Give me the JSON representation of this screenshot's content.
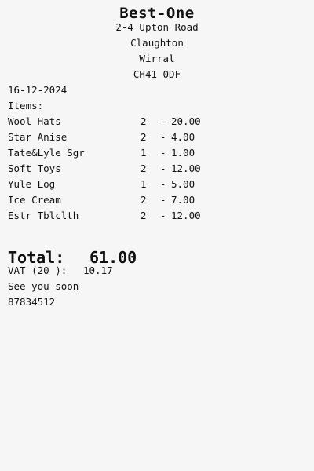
{
  "store": {
    "name": "Best-One",
    "address": [
      "2-4 Upton Road",
      "Claughton",
      "Wirral",
      "CH41 0DF"
    ]
  },
  "date": "16-12-2024",
  "items_label": "Items:",
  "items": [
    {
      "name": "Wool Hats",
      "qty": "2",
      "sep": "-",
      "price": "20.00"
    },
    {
      "name": "Star Anise",
      "qty": "2",
      "sep": "-",
      "price": "4.00"
    },
    {
      "name": "Tate&Lyle Sgr",
      "qty": "1",
      "sep": "-",
      "price": "1.00"
    },
    {
      "name": "Soft Toys",
      "qty": "2",
      "sep": "-",
      "price": "12.00"
    },
    {
      "name": "Yule Log",
      "qty": "1",
      "sep": "-",
      "price": "5.00"
    },
    {
      "name": "Ice Cream",
      "qty": "2",
      "sep": "-",
      "price": "7.00"
    },
    {
      "name": "Estr Tblclth",
      "qty": "2",
      "sep": "-",
      "price": "12.00"
    }
  ],
  "total": {
    "label": "Total:",
    "value": "61.00"
  },
  "vat": {
    "label": "VAT (20 ):",
    "value": "10.17"
  },
  "footer": "See you soon",
  "number": "87834512"
}
